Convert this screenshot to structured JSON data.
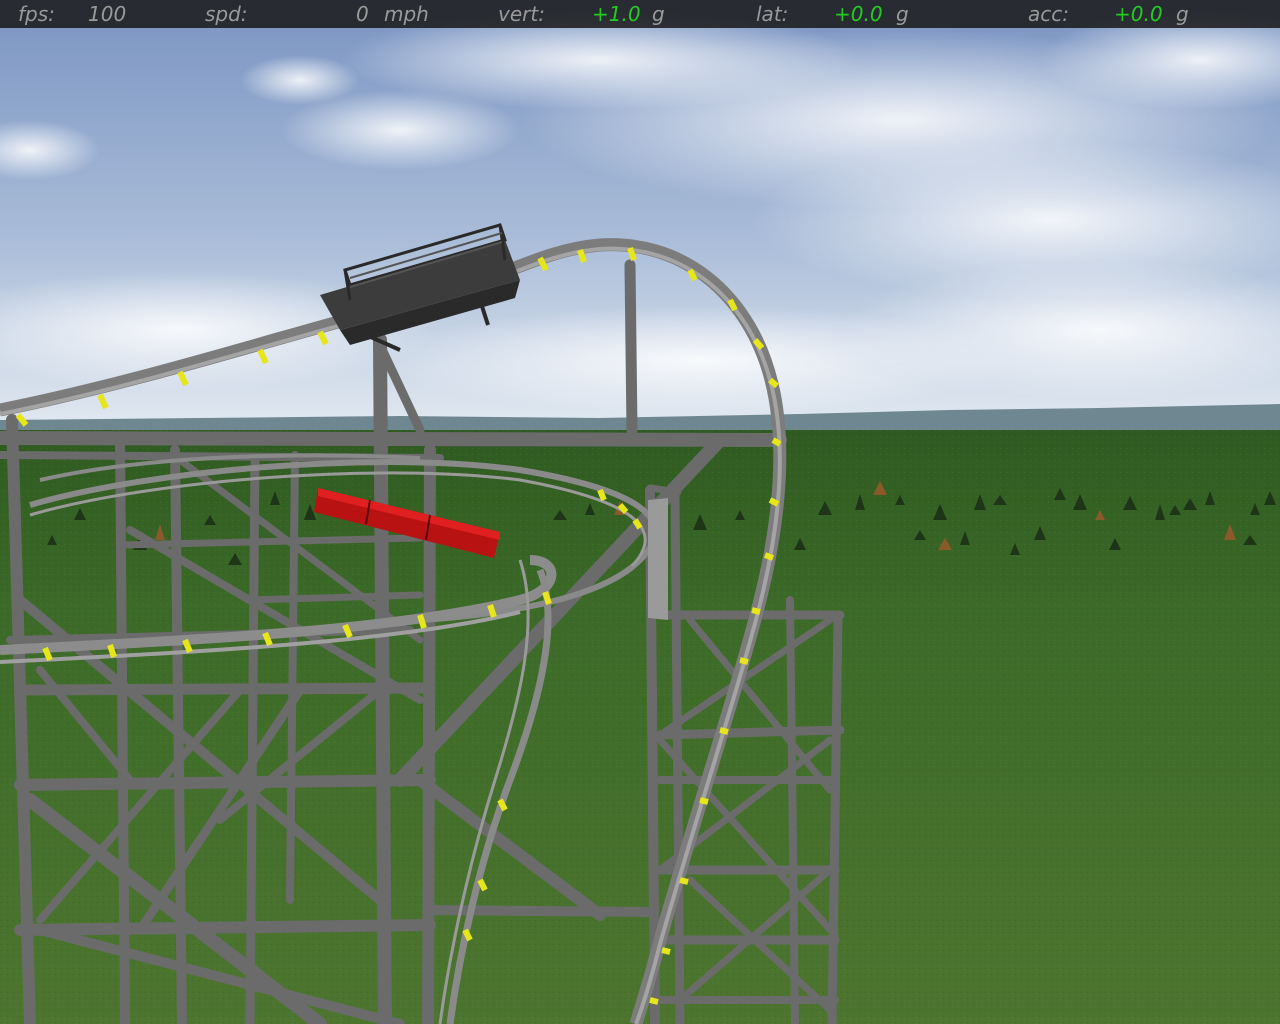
{
  "hud": {
    "fps_label": "fps:",
    "fps_value": "100",
    "spd_label": "spd:",
    "spd_value": "0",
    "spd_unit": "mph",
    "vert_label": "vert:",
    "vert_value": "+1.0",
    "vert_unit": "g",
    "lat_label": "lat:",
    "lat_value": "+0.0",
    "lat_unit": "g",
    "acc_label": "acc:",
    "acc_value": "+0.0",
    "acc_unit": "g"
  },
  "colors": {
    "hud_background": "#1c1c1c",
    "hud_label": "#9a9a9a",
    "hud_positive_value": "#22cc22",
    "sky_top": "#7e97c4",
    "sky_horizon": "#dde6f0",
    "distant_hills": "#6f8790",
    "grass": "#3f6628",
    "steel_structure": "#6b6b6b",
    "track_rail": "#8a8a8a",
    "track_tie": "#e6e61a",
    "train_car": "#c01414",
    "lift_platform": "#3a3a3a"
  }
}
